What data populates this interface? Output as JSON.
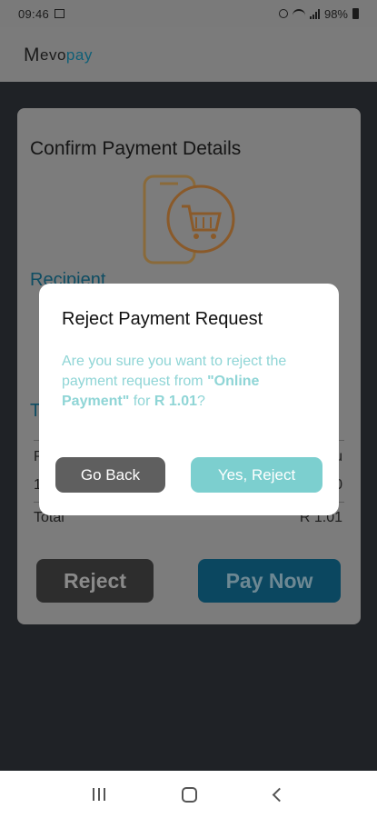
{
  "status_bar": {
    "time": "09:46",
    "battery": "98%"
  },
  "app": {
    "logo_m": "M",
    "logo_evo": "evo",
    "logo_pay": "pay"
  },
  "card": {
    "title": "Confirm Payment Details",
    "recipient_label": "Recipient",
    "t_label": "T",
    "row1_left": "P",
    "row1_right": "u",
    "row2_left": "1",
    "row2_right": "0",
    "total_label": "Total",
    "total_value": "R 1.01",
    "reject_label": "Reject",
    "pay_now_label": "Pay Now"
  },
  "dialog": {
    "title": "Reject Payment Request",
    "message_before": "Are you sure you want to reject the payment request from ",
    "merchant": "\"Online Payment\"",
    "message_middle": " for ",
    "amount": "R 1.01",
    "message_after": "?",
    "go_back_label": "Go Back",
    "confirm_label": "Yes, Reject"
  },
  "colors": {
    "accent_teal": "#7ccfcf",
    "brand_blue": "#0f8fbf",
    "dim_background": "#1f2226"
  }
}
